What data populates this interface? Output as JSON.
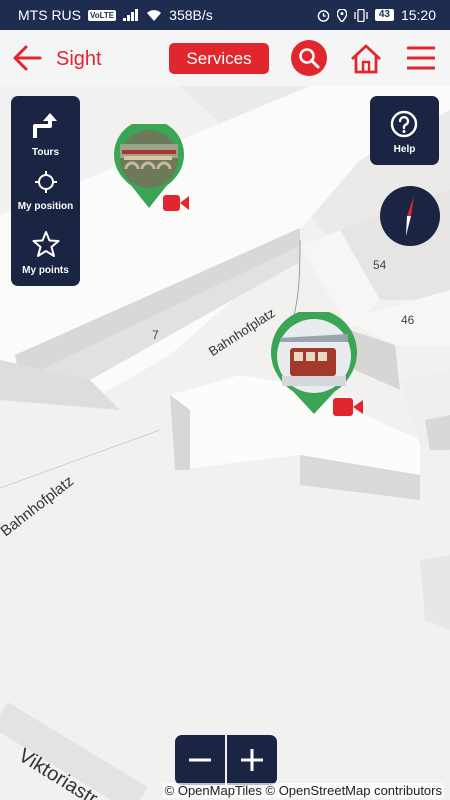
{
  "status_bar": {
    "carrier": "MTS RUS",
    "volte": "VoLTE",
    "speed": "358B/s",
    "battery": "43",
    "time": "15:20"
  },
  "app_bar": {
    "title": "Sight",
    "services_label": "Services",
    "icons": [
      "back-arrow-icon",
      "search-icon",
      "home-icon",
      "menu-icon"
    ]
  },
  "side_panel": {
    "items": [
      {
        "label": "Tours",
        "icon": "route-icon"
      },
      {
        "label": "My position",
        "icon": "crosshair-icon"
      },
      {
        "label": "My points",
        "icon": "star-icon"
      }
    ]
  },
  "help": {
    "label": "Help",
    "icon": "question-icon"
  },
  "map": {
    "numbers": [
      "54",
      "46",
      "7"
    ],
    "streets": [
      "Bahnhofplatz",
      "Bahnhofplatz",
      "Viktoriastr"
    ],
    "attribution": "© OpenMapTiles © OpenStreetMap contributors"
  },
  "zoom": {
    "minus": "−",
    "plus": "+"
  },
  "colors": {
    "accent": "#e1262e",
    "panel": "#1c2444",
    "pin_ring": "#3aa655",
    "status_bar": "#1d2c4f"
  }
}
